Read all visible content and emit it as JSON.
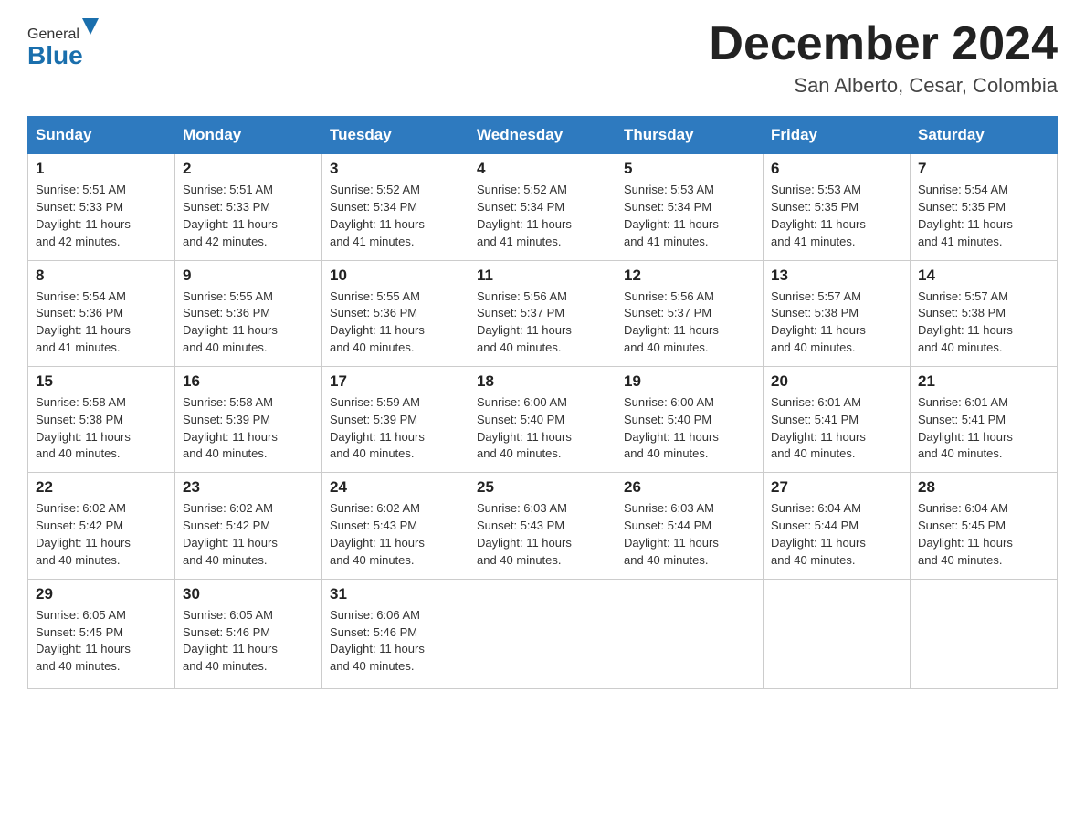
{
  "header": {
    "logo_general": "General",
    "logo_blue": "Blue",
    "month_title": "December 2024",
    "location": "San Alberto, Cesar, Colombia"
  },
  "weekdays": [
    "Sunday",
    "Monday",
    "Tuesday",
    "Wednesday",
    "Thursday",
    "Friday",
    "Saturday"
  ],
  "weeks": [
    [
      {
        "day": "1",
        "sunrise": "5:51 AM",
        "sunset": "5:33 PM",
        "daylight": "11 hours and 42 minutes."
      },
      {
        "day": "2",
        "sunrise": "5:51 AM",
        "sunset": "5:33 PM",
        "daylight": "11 hours and 42 minutes."
      },
      {
        "day": "3",
        "sunrise": "5:52 AM",
        "sunset": "5:34 PM",
        "daylight": "11 hours and 41 minutes."
      },
      {
        "day": "4",
        "sunrise": "5:52 AM",
        "sunset": "5:34 PM",
        "daylight": "11 hours and 41 minutes."
      },
      {
        "day": "5",
        "sunrise": "5:53 AM",
        "sunset": "5:34 PM",
        "daylight": "11 hours and 41 minutes."
      },
      {
        "day": "6",
        "sunrise": "5:53 AM",
        "sunset": "5:35 PM",
        "daylight": "11 hours and 41 minutes."
      },
      {
        "day": "7",
        "sunrise": "5:54 AM",
        "sunset": "5:35 PM",
        "daylight": "11 hours and 41 minutes."
      }
    ],
    [
      {
        "day": "8",
        "sunrise": "5:54 AM",
        "sunset": "5:36 PM",
        "daylight": "11 hours and 41 minutes."
      },
      {
        "day": "9",
        "sunrise": "5:55 AM",
        "sunset": "5:36 PM",
        "daylight": "11 hours and 40 minutes."
      },
      {
        "day": "10",
        "sunrise": "5:55 AM",
        "sunset": "5:36 PM",
        "daylight": "11 hours and 40 minutes."
      },
      {
        "day": "11",
        "sunrise": "5:56 AM",
        "sunset": "5:37 PM",
        "daylight": "11 hours and 40 minutes."
      },
      {
        "day": "12",
        "sunrise": "5:56 AM",
        "sunset": "5:37 PM",
        "daylight": "11 hours and 40 minutes."
      },
      {
        "day": "13",
        "sunrise": "5:57 AM",
        "sunset": "5:38 PM",
        "daylight": "11 hours and 40 minutes."
      },
      {
        "day": "14",
        "sunrise": "5:57 AM",
        "sunset": "5:38 PM",
        "daylight": "11 hours and 40 minutes."
      }
    ],
    [
      {
        "day": "15",
        "sunrise": "5:58 AM",
        "sunset": "5:38 PM",
        "daylight": "11 hours and 40 minutes."
      },
      {
        "day": "16",
        "sunrise": "5:58 AM",
        "sunset": "5:39 PM",
        "daylight": "11 hours and 40 minutes."
      },
      {
        "day": "17",
        "sunrise": "5:59 AM",
        "sunset": "5:39 PM",
        "daylight": "11 hours and 40 minutes."
      },
      {
        "day": "18",
        "sunrise": "6:00 AM",
        "sunset": "5:40 PM",
        "daylight": "11 hours and 40 minutes."
      },
      {
        "day": "19",
        "sunrise": "6:00 AM",
        "sunset": "5:40 PM",
        "daylight": "11 hours and 40 minutes."
      },
      {
        "day": "20",
        "sunrise": "6:01 AM",
        "sunset": "5:41 PM",
        "daylight": "11 hours and 40 minutes."
      },
      {
        "day": "21",
        "sunrise": "6:01 AM",
        "sunset": "5:41 PM",
        "daylight": "11 hours and 40 minutes."
      }
    ],
    [
      {
        "day": "22",
        "sunrise": "6:02 AM",
        "sunset": "5:42 PM",
        "daylight": "11 hours and 40 minutes."
      },
      {
        "day": "23",
        "sunrise": "6:02 AM",
        "sunset": "5:42 PM",
        "daylight": "11 hours and 40 minutes."
      },
      {
        "day": "24",
        "sunrise": "6:02 AM",
        "sunset": "5:43 PM",
        "daylight": "11 hours and 40 minutes."
      },
      {
        "day": "25",
        "sunrise": "6:03 AM",
        "sunset": "5:43 PM",
        "daylight": "11 hours and 40 minutes."
      },
      {
        "day": "26",
        "sunrise": "6:03 AM",
        "sunset": "5:44 PM",
        "daylight": "11 hours and 40 minutes."
      },
      {
        "day": "27",
        "sunrise": "6:04 AM",
        "sunset": "5:44 PM",
        "daylight": "11 hours and 40 minutes."
      },
      {
        "day": "28",
        "sunrise": "6:04 AM",
        "sunset": "5:45 PM",
        "daylight": "11 hours and 40 minutes."
      }
    ],
    [
      {
        "day": "29",
        "sunrise": "6:05 AM",
        "sunset": "5:45 PM",
        "daylight": "11 hours and 40 minutes."
      },
      {
        "day": "30",
        "sunrise": "6:05 AM",
        "sunset": "5:46 PM",
        "daylight": "11 hours and 40 minutes."
      },
      {
        "day": "31",
        "sunrise": "6:06 AM",
        "sunset": "5:46 PM",
        "daylight": "11 hours and 40 minutes."
      },
      null,
      null,
      null,
      null
    ]
  ],
  "labels": {
    "sunrise": "Sunrise:",
    "sunset": "Sunset:",
    "daylight": "Daylight:"
  }
}
